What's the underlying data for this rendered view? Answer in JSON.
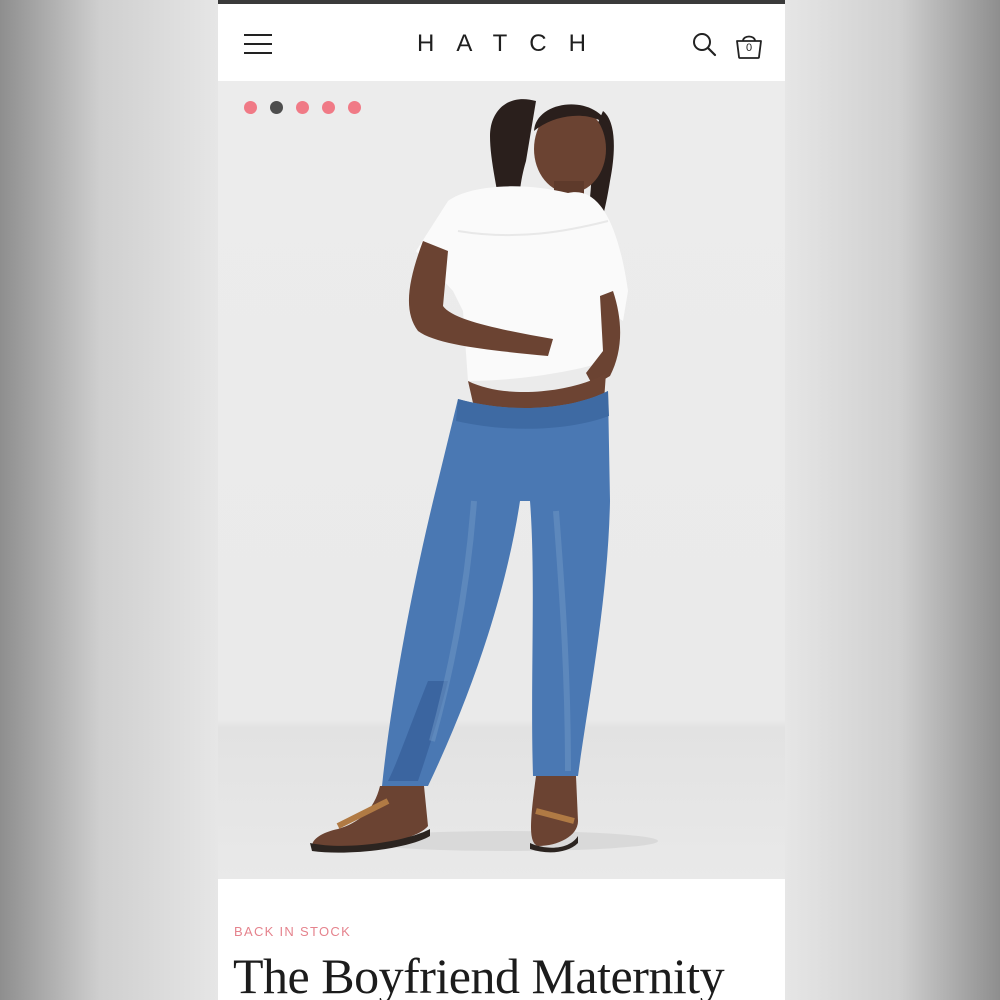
{
  "header": {
    "logo": "HATCH",
    "menu_icon": "hamburger-menu-icon",
    "search_icon": "search-icon",
    "cart_icon": "shopping-bag-icon",
    "cart_count": "0"
  },
  "carousel": {
    "total_slides": 5,
    "active_index": 1,
    "dot_color": "#f07a86",
    "active_dot_color": "#4e4e4e"
  },
  "product": {
    "badge": "BACK IN STOCK",
    "badge_color": "#e5838d",
    "title": "The Boyfriend Maternity"
  }
}
